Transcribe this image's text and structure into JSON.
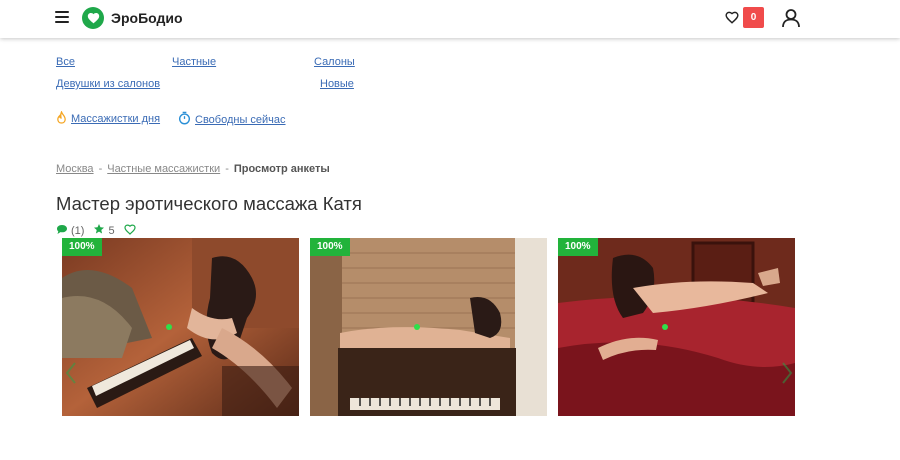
{
  "header": {
    "logo_text": "ЭроБодио",
    "favorites_count": "0",
    "icons": [
      "menu-icon",
      "heart-logo-icon",
      "heart-icon",
      "user-icon"
    ]
  },
  "categories": [
    "Все",
    "Частные",
    "Салоны",
    "Девушки из салонов",
    "Новые"
  ],
  "quick_links": {
    "day": "Массажистки дня",
    "free": "Свободны сейчас"
  },
  "breadcrumb": {
    "city": "Москва",
    "section": "Частные массажистки",
    "current": "Просмотр анкеты"
  },
  "profile": {
    "title": "Мастер эротического массажа Катя",
    "comments": "(1)",
    "rating": "5"
  },
  "photos": [
    {
      "badge": "100%"
    },
    {
      "badge": "100%"
    },
    {
      "badge": "100%"
    }
  ],
  "colors": {
    "brand_green": "#1fa84a",
    "badge_green": "#22b33b",
    "badge_red": "#f04b4b",
    "link_blue": "#3a6bb5"
  }
}
